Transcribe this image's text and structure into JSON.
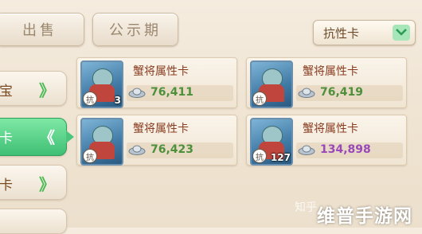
{
  "tabs": {
    "sell_label": "出售",
    "notice_label": "公示期"
  },
  "filter": {
    "selected": "抗性卡"
  },
  "sidebar": {
    "items": [
      {
        "label": "宝",
        "arrow": "》"
      },
      {
        "label": "卡",
        "arrow": "《"
      },
      {
        "label": "卡",
        "arrow": "》"
      }
    ]
  },
  "listings": [
    {
      "name": "蟹将属性卡",
      "badge": "抗",
      "count": "3",
      "price": "76,411",
      "price_color": "#4e8f3a"
    },
    {
      "name": "蟹将属性卡",
      "badge": "抗",
      "count": "",
      "price": "76,419",
      "price_color": "#4e8f3a"
    },
    {
      "name": "蟹将属性卡",
      "badge": "抗",
      "count": "",
      "price": "76,423",
      "price_color": "#4e8f3a"
    },
    {
      "name": "蟹将属性卡",
      "badge": "抗",
      "count": "127",
      "price": "134,898",
      "price_color": "#9a48b8"
    }
  ],
  "watermark": {
    "prefix": "知乎",
    "brand": "维普手游网"
  },
  "icons": {
    "dropdown": "chevron-down-icon",
    "currency": "silver-ingot-icon"
  },
  "colors": {
    "accent_green": "#4cc57c",
    "price_green": "#4e8f3a",
    "price_purple": "#9a48b8"
  }
}
